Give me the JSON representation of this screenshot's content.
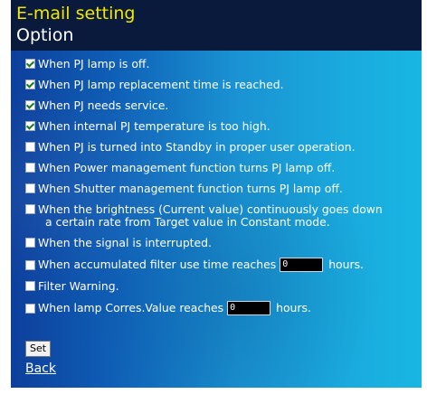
{
  "header": {
    "title": "E-mail setting",
    "subtitle": "Option"
  },
  "options": [
    {
      "label": "When PJ lamp is off.",
      "checked": true
    },
    {
      "label": "When PJ lamp replacement time is reached.",
      "checked": true
    },
    {
      "label": "When PJ needs service.",
      "checked": true
    },
    {
      "label": "When internal PJ temperature is too high.",
      "checked": true
    },
    {
      "label": "When PJ is turned into Standby in proper user operation.",
      "checked": false
    },
    {
      "label": "When Power management function turns PJ lamp off.",
      "checked": false
    },
    {
      "label": "When Shutter management function turns PJ lamp off.",
      "checked": false
    },
    {
      "label_line1": "When the brightness (Current value) continuously goes down",
      "label_line2": "a certain rate from Target value in Constant mode.",
      "checked": false
    },
    {
      "label": "When the signal is interrupted.",
      "checked": false
    },
    {
      "label_prefix": "When accumulated filter use time reaches",
      "value": "0",
      "suffix": "hours.",
      "checked": false
    },
    {
      "label": "Filter Warning.",
      "checked": false
    },
    {
      "label_prefix": "When lamp Corres.Value reaches",
      "value": "0",
      "suffix": "hours.",
      "checked": false
    }
  ],
  "actions": {
    "set_label": "Set",
    "back_label": "Back"
  }
}
